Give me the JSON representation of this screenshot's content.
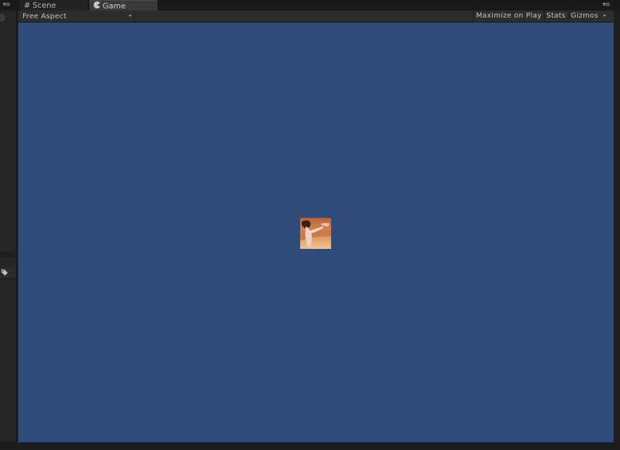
{
  "tabs": [
    {
      "label": "Scene",
      "icon": "grid-icon",
      "active": false
    },
    {
      "label": "Game",
      "icon": "pacman-icon",
      "active": true
    }
  ],
  "toolbar": {
    "aspect": "Free Aspect",
    "maximize": "Maximize on Play",
    "stats": "Stats",
    "gizmos": "Gizmos"
  },
  "viewport": {
    "background": "#304d7a",
    "sprite": "character-sprite"
  }
}
